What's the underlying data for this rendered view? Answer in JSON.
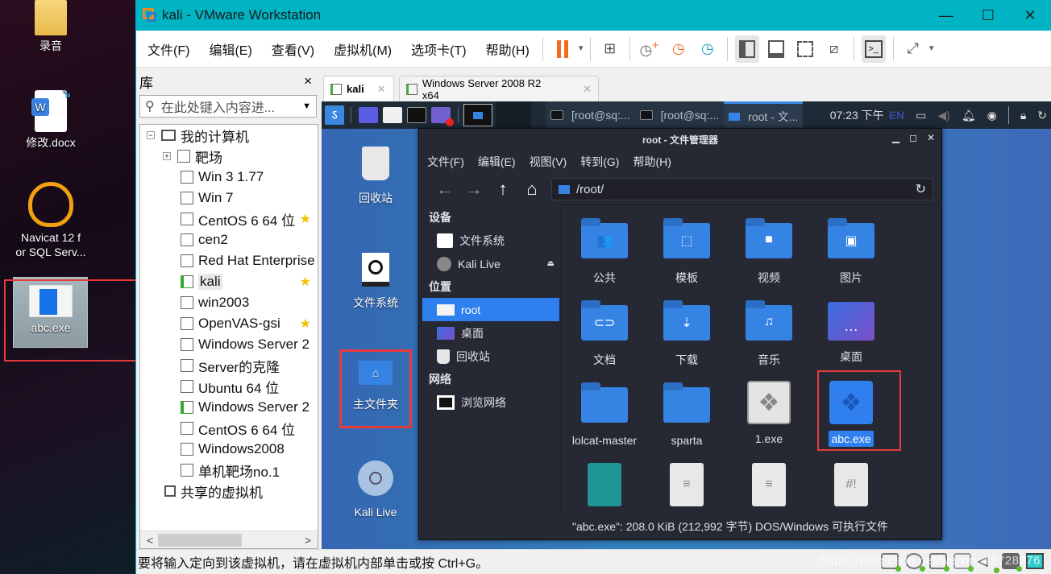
{
  "desktop": {
    "icons": [
      {
        "label": "录音",
        "icon": "folder-icon"
      },
      {
        "label": "修改.docx",
        "icon": "word-document-icon"
      },
      {
        "label": "Navicat 12 for SQL Serv...",
        "label_line1": "Navicat 12 f",
        "label_line2": "or SQL Serv...",
        "icon": "navicat-icon"
      },
      {
        "label": "abc.exe",
        "icon": "exe-file-icon",
        "selected": true
      }
    ]
  },
  "vmware": {
    "title": "kali - VMware Workstation",
    "window_controls": {
      "minimize": "—",
      "maximize": "☐",
      "close": "✕"
    },
    "menu": [
      "文件(F)",
      "编辑(E)",
      "查看(V)",
      "虚拟机(M)",
      "选项卡(T)",
      "帮助(H)"
    ],
    "toolbar": [
      "pause-icon",
      "send-ctrl-alt-del-icon",
      "snapshot-take-icon",
      "snapshot-revert-icon",
      "snapshot-manager-icon",
      "library-view-icon",
      "thumbnail-bar-icon",
      "fullscreen-icon",
      "unity-icon",
      "console-icon",
      "stretch-icon"
    ],
    "library": {
      "title": "库",
      "close": "×",
      "search_placeholder": "在此处键入内容进...",
      "root": "我的计算机",
      "items": [
        {
          "label": "靶场",
          "type": "folder",
          "expandable": true
        },
        {
          "label": "Win 3  1.77",
          "type": "vm-clone"
        },
        {
          "label": "Win 7",
          "type": "vm"
        },
        {
          "label": "CentOS 6 64 位",
          "type": "vm",
          "starred": true
        },
        {
          "label": "cen2",
          "type": "vm"
        },
        {
          "label": "Red Hat Enterprise",
          "type": "vm"
        },
        {
          "label": "kali",
          "type": "vm",
          "running": true,
          "starred": true,
          "selected": true
        },
        {
          "label": "win2003",
          "type": "vm"
        },
        {
          "label": "OpenVAS-gsi",
          "type": "vm",
          "starred": true
        },
        {
          "label": "Windows Server 2",
          "type": "vm"
        },
        {
          "label": "Server的克隆",
          "type": "vm"
        },
        {
          "label": "Ubuntu 64 位",
          "type": "vm"
        },
        {
          "label": "Windows Server 2",
          "type": "vm",
          "running": true
        },
        {
          "label": "CentOS 6 64 位",
          "type": "vm"
        },
        {
          "label": "Windows2008",
          "type": "vm"
        },
        {
          "label": "单机靶场no.1",
          "type": "vm"
        }
      ],
      "shared": "共享的虚拟机"
    },
    "tabs": [
      {
        "label": "kali",
        "active": true
      },
      {
        "label": "Windows Server 2008 R2 x64",
        "active": false
      }
    ],
    "status_message": "要将输入定向到该虚拟机，请在虚拟机内部单击或按 Ctrl+G。",
    "watermark": "https://blog.csdn.net/weixin_45728976"
  },
  "kali": {
    "panel": {
      "tasks": [
        "[root@sq:...",
        "[root@sq:...",
        "root - 文..."
      ],
      "clock": "07:23 下午",
      "lang": "EN"
    },
    "desktop_icons": [
      "回收站",
      "文件系统",
      "主文件夹",
      "Kali Live"
    ],
    "file_manager": {
      "title": "root - 文件管理器",
      "menu": [
        "文件(F)",
        "编辑(E)",
        "视图(V)",
        "转到(G)",
        "帮助(H)"
      ],
      "location": "/root/",
      "sidebar": {
        "devices_header": "设备",
        "devices": [
          "文件系统",
          "Kali Live"
        ],
        "places_header": "位置",
        "places": [
          "root",
          "桌面",
          "回收站"
        ],
        "network_header": "网络",
        "network": [
          "浏览网络"
        ]
      },
      "items": [
        {
          "name": "公共",
          "icon": "folder-public-icon",
          "glyph": "👥"
        },
        {
          "name": "模板",
          "icon": "folder-templates-icon",
          "glyph": "⬚"
        },
        {
          "name": "视频",
          "icon": "folder-videos-icon",
          "glyph": "■"
        },
        {
          "name": "图片",
          "icon": "folder-pictures-icon",
          "glyph": "▣"
        },
        {
          "name": "文档",
          "icon": "folder-documents-icon",
          "glyph": "⊂⊃"
        },
        {
          "name": "下载",
          "icon": "folder-download-icon",
          "glyph": "⇣"
        },
        {
          "name": "音乐",
          "icon": "folder-music-icon",
          "glyph": "♫"
        },
        {
          "name": "桌面",
          "icon": "desktop-folder-icon",
          "glyph": "…"
        },
        {
          "name": "lolcat-master",
          "icon": "folder-icon",
          "glyph": ""
        },
        {
          "name": "sparta",
          "icon": "folder-icon",
          "glyph": ""
        },
        {
          "name": "1.exe",
          "icon": "exe-file-icon",
          "glyph": ""
        },
        {
          "name": "abc.exe",
          "icon": "exe-file-icon",
          "glyph": "",
          "selected": true
        },
        {
          "name": "",
          "icon": "archive-file-icon"
        },
        {
          "name": "",
          "icon": "text-file-icon"
        },
        {
          "name": "",
          "icon": "text-file-icon"
        },
        {
          "name": "",
          "icon": "script-file-icon",
          "glyph": "#!"
        }
      ],
      "status": "\"abc.exe\": 208.0 KiB (212,992 字节) DOS/Windows 可执行文件"
    }
  }
}
